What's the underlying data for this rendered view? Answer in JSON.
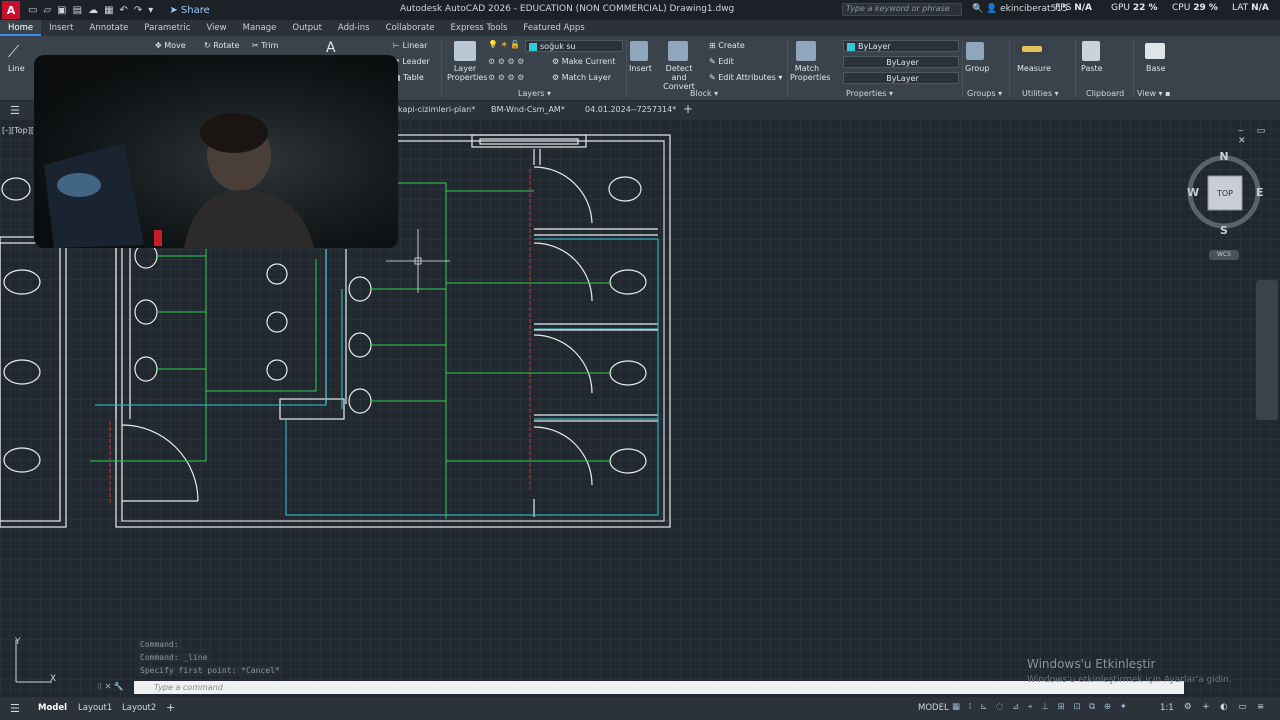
{
  "title_bar": {
    "app_title": "Autodesk AutoCAD 2026 - EDUCATION (NON COMMERCIAL)   Drawing1.dwg",
    "share_label": "Share",
    "search_placeholder": "Type a keyword or phrase",
    "user": "ekinciberat515",
    "fps_label": "FPS",
    "fps_value": "N/A",
    "gpu_label": "GPU",
    "gpu_value": "22 %",
    "cpu_label": "CPU",
    "cpu_value": "29 %",
    "lat_label": "LAT",
    "lat_value": "N/A",
    "logo_letter": "A"
  },
  "ribbon_tabs": [
    "Home",
    "Insert",
    "Annotate",
    "Parametric",
    "View",
    "Manage",
    "Output",
    "Add-ins",
    "Collaborate",
    "Express Tools",
    "Featured Apps"
  ],
  "ribbon": {
    "draw": {
      "line": "Line"
    },
    "modify": {
      "move": "Move",
      "rotate": "Rotate",
      "trim": "Trim"
    },
    "annotation": {
      "linear": "Linear",
      "leader": "Leader",
      "table": "Table"
    },
    "layers": {
      "layer_properties": "Layer Properties",
      "current_layer": "soğuk su",
      "make_current": "Make Current",
      "match_layer": "Match Layer",
      "panel": "Layers"
    },
    "block": {
      "insert": "Insert",
      "detect_convert": "Detect and Convert",
      "create": "Create",
      "edit": "Edit",
      "edit_attributes": "Edit Attributes",
      "panel": "Block"
    },
    "properties": {
      "match_properties": "Match Properties",
      "color": "ByLayer",
      "linetype": "ByLayer",
      "lineweight": "ByLayer",
      "panel": "Properties"
    },
    "groups": {
      "group": "Group",
      "panel": "Groups"
    },
    "utilities": {
      "measure": "Measure",
      "panel": "Utilities"
    },
    "clipboard": {
      "paste": "Paste",
      "panel": "Clipboard"
    },
    "view": {
      "base": "Base",
      "panel": "View"
    }
  },
  "file_tabs": [
    "kapi-cizimleri-plan*",
    "BM-Wnd-Csm_AM*",
    "04.01.2024--7257314*"
  ],
  "viewport_label": "[-][Top][",
  "navcube": {
    "n": "N",
    "s": "S",
    "e": "E",
    "w": "W",
    "top": "TOP",
    "wcs": "WCS"
  },
  "command": {
    "history": [
      "Command:",
      "Command: _line",
      "Specify first point: *Cancel*"
    ],
    "placeholder": "Type a command"
  },
  "status_tabs": [
    "Model",
    "Layout1",
    "Layout2"
  ],
  "status": {
    "model_label": "MODEL",
    "scale": "1:1"
  },
  "watermark": {
    "line1": "Windows'u Etkinleştir",
    "line2": "Windows'u etkinleştirmek için Ayarlar'a gidin."
  },
  "colors": {
    "accent": "#3b8eea",
    "layer_green": "#2fd04f",
    "layer_cyan": "#35c9d6",
    "layer_red": "#d0303a",
    "wall_white": "#e8ecef"
  }
}
